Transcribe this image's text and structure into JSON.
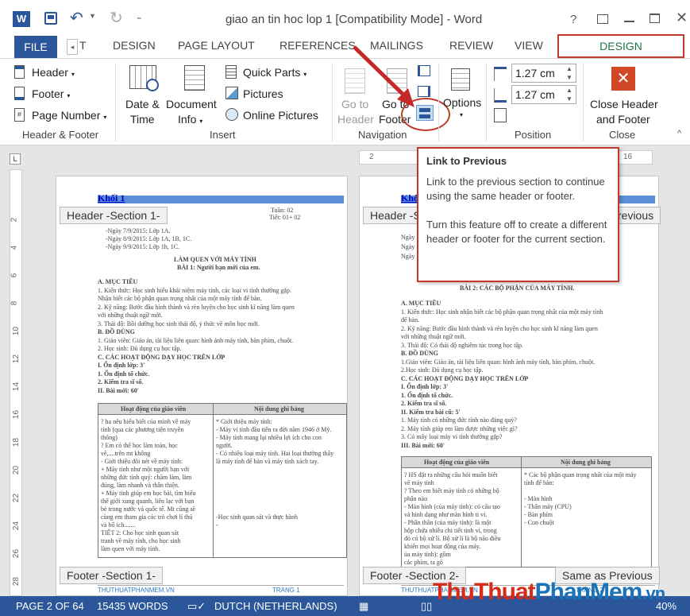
{
  "title_bar": {
    "title": "giao an tin hoc lop 1 [Compatibility Mode] - Word",
    "help": "?"
  },
  "tabs": {
    "file": "FILE",
    "partial_t": "T",
    "design": "DESIGN",
    "page_layout": "PAGE LAYOUT",
    "references": "REFERENCES",
    "mailings": "MAILINGS",
    "review": "REVIEW",
    "view": "VIEW",
    "contextual_design": "DESIGN"
  },
  "ribbon": {
    "header": "Header",
    "footer": "Footer",
    "page_number": "Page Number",
    "group_header_footer": "Header & Footer",
    "date_time_1": "Date &",
    "date_time_2": "Time",
    "doc_info_1": "Document",
    "doc_info_2": "Info",
    "quick_parts": "Quick Parts",
    "pictures": "Pictures",
    "online_pictures": "Online Pictures",
    "group_insert": "Insert",
    "goto_header_1": "Go to",
    "goto_header_2": "Header",
    "goto_footer_1": "Go to",
    "goto_footer_2": "Footer",
    "group_navigation": "Navigation",
    "options": "Options",
    "header_pos": "1.27 cm",
    "footer_pos": "1.27 cm",
    "group_position": "Position",
    "close_1": "Close Header",
    "close_2": "and Footer",
    "group_close": "Close"
  },
  "tooltip": {
    "title": "Link to Previous",
    "p1": "Link to the previous section to continue using the same header or footer.",
    "p2": "Turn this feature off to create a different header or footer for the current section."
  },
  "page1": {
    "header_text": "Khối 1",
    "header_tag": "Header -Section 1-",
    "footer_tag": "Footer -Section 1-",
    "footer_left": "THUTHUATPHANMEM.VN",
    "footer_right": "TRANG 1",
    "week": "Tuần: 02",
    "period": "Tiết: 01+ 02",
    "dates": [
      "-Ngày 7/9/2015: Lớp 1A.",
      "-Ngày 8/9/2015: Lớp 1A, 1B, 1C.",
      "-Ngày 9/9/2015: Lớp 1h, 1C."
    ],
    "lesson_title": "LÀM QUEN VỚI MÁY TÍNH",
    "lesson_sub": "BÀI 1: Người bạn mới của em.",
    "body": [
      "A. MỤC TIÊU",
      "1. Kiến thức: Học sinh hiểu khái niệm máy tính, các loại vi tính thường gặp.",
      "Nhận biết các bộ phận quan trọng nhất của một máy tính để bàn.",
      "2. Kỹ năng: Bước đầu hình thành và rèn luyện cho học sinh kĩ năng làm quen",
      "với những thuật ngữ mới.",
      "3. Thái độ: Bồi dưỡng học sinh thái độ, ý thức về môn học mới.",
      "B. ĐỒ DÙNG",
      "1. Giáo viên: Giáo án, tài liệu liên quan: hình ảnh máy tính, bàn phím, chuột.",
      "2. Học sinh: Đủ dụng cụ học tập.",
      "C. CÁC HOẠT ĐỘNG DẠY HỌC TRÊN LỚP",
      "I. Ổn định lớp: 3'",
      "1. Ổn định tổ chức.",
      "2. Kiểm tra sĩ số.",
      "II. Bài mới: 60'"
    ],
    "table_h1": "Hoạt động của giáo viên",
    "table_h2": "Nội dung ghi bảng",
    "col1": [
      "? ha nêu hiểu biết của mình về máy",
      "tính (qua các phương tiện truyền",
      "thông)",
      "? Em có thể học làm toán, học",
      "vẽ,....trên mt không",
      "- Giới thiệu đôi nét về máy tính:",
      "+ Máy tính như một người bạn với",
      "những đức tính quý: chăm làm, làm",
      "đúng, làm nhanh và thân thiện.",
      "+ Máy tính giúp em học bài, tìm hiểu",
      "thế giới xung quanh, liên lạc với bạn",
      "bè trong nước và quốc tế. Mt cũng sẽ",
      "cùng em tham gia các trò chơi lí thú",
      "và bổ ích.......",
      "TIẾT 2: Cho học sinh quan sát",
      "tranh về máy tính, cho học sinh",
      "làm quen với máy tính."
    ],
    "col2": [
      "* Giới thiệu máy tính:",
      "- Máy vi tính đầu tiên ra đời năm 1946 ở Mỹ.",
      "- Máy tính mang lại nhiều lợi ích cho con",
      "người.",
      "- Có nhiều loại máy tính. Hai loại thường thấy",
      "là máy tính để bàn và máy tính xách tay.",
      "",
      "",
      "",
      "",
      "",
      "",
      "-Học sinh quan sát và thực hành",
      "-"
    ]
  },
  "page2": {
    "header_text": "Khối",
    "header_tag": "Header -S",
    "header_previous": "revious",
    "footer_tag": "Footer -Section 2-",
    "same_as_previous": "Same as Previous",
    "footer_left": "THUTHUATPHANMEM.VN",
    "footer_right": "TRANG 2",
    "partial_dates": [
      "Ngày",
      "Ngày",
      "Ngày"
    ],
    "lesson_sub": "BÀI 2: CÁC BỘ PHẬN CỦA MÁY TÍNH.",
    "body": [
      "A. MỤC TIÊU",
      "1. Kiến thức: Học sinh nhận biết các bộ phận quan trọng nhất của một máy tính",
      "để bàn.",
      "2. Kỹ năng: Bước đầu hình thành và rèn luyện cho học sinh kĩ năng làm quen",
      "với những thuật ngữ mới.",
      "3. Thái độ: Có thái độ nghiêm túc trong học tập.",
      "B. ĐỒ DÙNG",
      "1.Giáo viên: Giáo án, tài liệu liên quan: hình ảnh máy tính, bàn phím, chuột.",
      "2.Học sinh: Đủ dụng cụ học tập.",
      "C. CÁC HOẠT ĐỘNG DẠY HỌC TRÊN LỚP",
      "I. Ổn định lớp: 3'",
      "1. Ổn định tổ chức.",
      "2. Kiểm tra sĩ số.",
      "II. Kiểm tra bài cũ: 5'",
      "1. Máy tính có những đức tính nào đáng quý?",
      "2. Máy tính giúp em làm được những việc gì?",
      "3. Có mấy loại máy vi tính thường gặp?",
      "III. Bài mới: 60'"
    ],
    "table_h1": "Hoạt động của giáo viên",
    "table_h2": "Nội dung ghi bảng",
    "col1": [
      "? HS đặt ra những câu hỏi muốn biết",
      "về máy tính",
      "? Theo em biết máy tính có những bộ",
      "phận nào",
      "- Màn hình (của máy tính): có cấu tạo",
      "và hình dạng như màn hình ti vi.",
      "- Phần thân (của máy tính): là một",
      "hộp chứa nhiều chi tiết tinh vi, trong",
      "đó có bộ xử lí. Bộ xử lí là bộ não điều",
      "khiển mọi hoạt động của máy.",
      "ủa máy tính): gồm",
      "các phím, ta gõ"
    ],
    "col2": [
      "* Các bộ phận quan trọng nhất của một máy",
      "tính để bàn:",
      "",
      "- Màn hình",
      "- Thân máy (CPU)",
      "- Bàn phím",
      "- Con chuột"
    ]
  },
  "rulers": {
    "h_left": "2",
    "h_right": "16",
    "v": [
      "2",
      "4",
      "6",
      "8",
      "10",
      "12",
      "14",
      "16",
      "18",
      "20",
      "22",
      "24",
      "26",
      "28"
    ]
  },
  "status": {
    "page": "PAGE 2 OF 64",
    "words": "15435 WORDS",
    "language": "DUTCH (NETHERLANDS)",
    "zoom": "40%"
  },
  "watermark": {
    "part1": "Thu",
    "part2": "Thuat",
    "part3": "PhanMem",
    "part4": ".vn"
  },
  "colors": {
    "accent": "#2b579a",
    "contextual": "#217346",
    "highlight": "#c0392b"
  }
}
